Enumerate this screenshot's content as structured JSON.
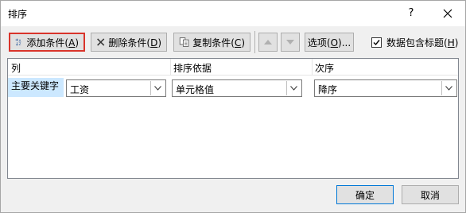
{
  "window": {
    "title": "排序",
    "help": "?"
  },
  "toolbar": {
    "add_label": "添加条件(",
    "add_key": "A",
    "add_tail": ")",
    "delete_label": "删除条件(",
    "delete_key": "D",
    "delete_tail": ")",
    "copy_label": "复制条件(",
    "copy_key": "C",
    "copy_tail": ")",
    "options_label": "选项(",
    "options_key": "O",
    "options_tail": ")...",
    "header_checkbox_label": "数据包含标题(",
    "header_checkbox_key": "H",
    "header_checkbox_tail": ")",
    "header_checkbox_checked": true
  },
  "columns": {
    "col": "列",
    "sort_on": "排序依据",
    "order": "次序"
  },
  "rows": [
    {
      "label": "主要关键字",
      "column": "工资",
      "sort_on": "单元格值",
      "order": "降序"
    }
  ],
  "footer": {
    "ok": "确定",
    "cancel": "取消"
  },
  "colors": {
    "highlight_border": "#d9342b",
    "selection": "#cce8ff",
    "focus_border": "#0078d7"
  }
}
